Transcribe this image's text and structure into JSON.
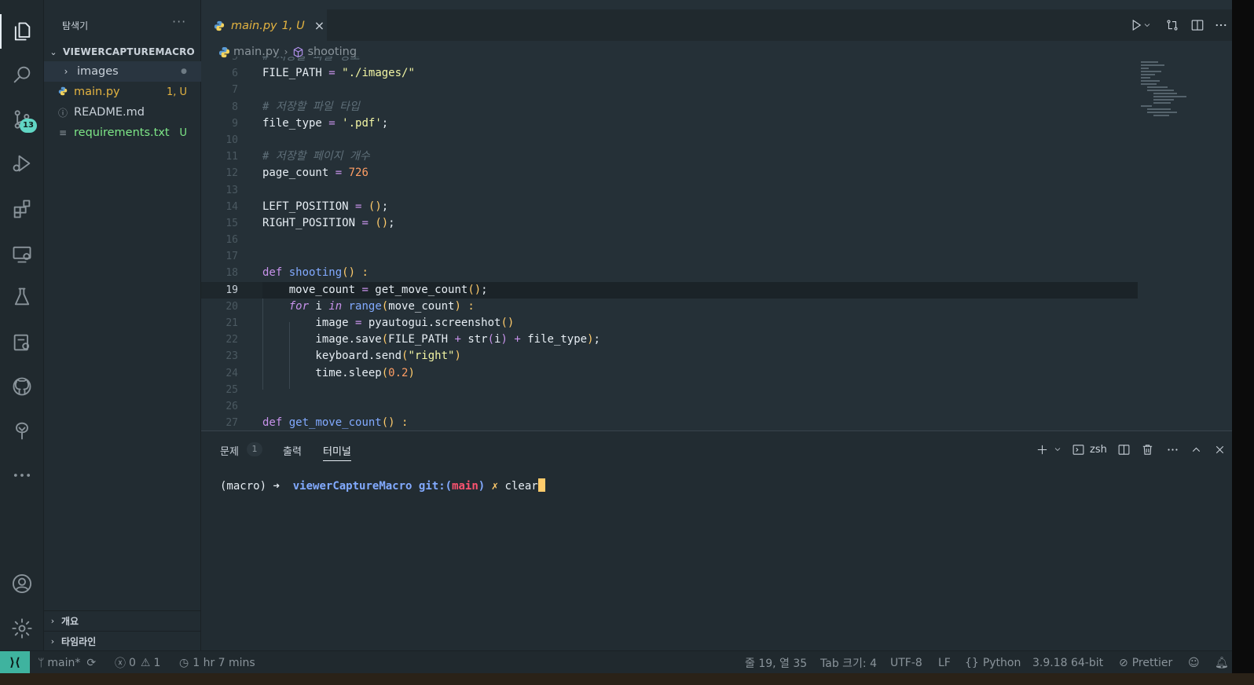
{
  "sidebar": {
    "title": "탐색기",
    "more": "···",
    "root": "VIEWERCAPTUREMACRO",
    "items": [
      {
        "label": "images",
        "status": "●",
        "icon": "chevron-right-icon",
        "color": "#c9d1d9"
      },
      {
        "label": "main.py",
        "status": "1, U",
        "icon": "python-icon",
        "color": "#e3b341"
      },
      {
        "label": "README.md",
        "status": "",
        "icon": "info-icon",
        "color": "#c9d1d9"
      },
      {
        "label": "requirements.txt",
        "status": "U",
        "icon": "lines-icon",
        "color": "#7ee787"
      }
    ],
    "outline_label": "개요",
    "timeline_label": "타임라인"
  },
  "activity": {
    "scm_badge": "13"
  },
  "tab": {
    "name": "main.py",
    "status": "1, U",
    "close": "×"
  },
  "breadcrumb": {
    "file": "main.py",
    "symbol": "shooting"
  },
  "code": [
    {
      "n": "5",
      "segs": [
        {
          "t": "# 저장할 파일 경로",
          "c": "c-com"
        }
      ]
    },
    {
      "n": "6",
      "segs": [
        {
          "t": "FILE_PATH ",
          "c": ""
        },
        {
          "t": "=",
          "c": "c-op"
        },
        {
          "t": " ",
          "c": ""
        },
        {
          "t": "\"./images/\"",
          "c": "c-strv"
        }
      ]
    },
    {
      "n": "7",
      "segs": []
    },
    {
      "n": "8",
      "segs": [
        {
          "t": "# 저장할 파일 타입",
          "c": "c-com"
        }
      ]
    },
    {
      "n": "9",
      "segs": [
        {
          "t": "file_type ",
          "c": ""
        },
        {
          "t": "=",
          "c": "c-op"
        },
        {
          "t": " ",
          "c": ""
        },
        {
          "t": "'.pdf'",
          "c": "c-strv"
        },
        {
          "t": ";",
          "c": ""
        }
      ]
    },
    {
      "n": "10",
      "segs": []
    },
    {
      "n": "11",
      "segs": [
        {
          "t": "# 저장할 페이지 개수",
          "c": "c-com"
        }
      ]
    },
    {
      "n": "12",
      "segs": [
        {
          "t": "page_count ",
          "c": ""
        },
        {
          "t": "=",
          "c": "c-op"
        },
        {
          "t": " ",
          "c": ""
        },
        {
          "t": "726",
          "c": "c-num"
        }
      ]
    },
    {
      "n": "13",
      "segs": []
    },
    {
      "n": "14",
      "segs": [
        {
          "t": "LEFT_POSITION ",
          "c": ""
        },
        {
          "t": "=",
          "c": "c-op"
        },
        {
          "t": " ",
          "c": ""
        },
        {
          "t": "()",
          "c": "c-pn"
        },
        {
          "t": ";",
          "c": ""
        }
      ]
    },
    {
      "n": "15",
      "segs": [
        {
          "t": "RIGHT_POSITION ",
          "c": ""
        },
        {
          "t": "=",
          "c": "c-op"
        },
        {
          "t": " ",
          "c": ""
        },
        {
          "t": "()",
          "c": "c-pn"
        },
        {
          "t": ";",
          "c": ""
        }
      ]
    },
    {
      "n": "16",
      "segs": []
    },
    {
      "n": "17",
      "segs": []
    },
    {
      "n": "18",
      "segs": [
        {
          "t": "def",
          "c": "c-kw"
        },
        {
          "t": " ",
          "c": ""
        },
        {
          "t": "shooting",
          "c": "c-fn"
        },
        {
          "t": "()",
          "c": "c-pn"
        },
        {
          "t": " ",
          "c": ""
        },
        {
          "t": ":",
          "c": "c-pn"
        }
      ]
    },
    {
      "n": "19",
      "cur": true,
      "segs": [
        {
          "t": "    move_count ",
          "c": ""
        },
        {
          "t": "=",
          "c": "c-op"
        },
        {
          "t": " get_move_count",
          "c": ""
        },
        {
          "t": "()",
          "c": "c-pn"
        },
        {
          "t": ";",
          "c": ""
        }
      ]
    },
    {
      "n": "20",
      "segs": [
        {
          "t": "    ",
          "c": ""
        },
        {
          "t": "for",
          "c": "c-kwi"
        },
        {
          "t": " i ",
          "c": ""
        },
        {
          "t": "in",
          "c": "c-kwi"
        },
        {
          "t": " ",
          "c": ""
        },
        {
          "t": "range",
          "c": "c-fn"
        },
        {
          "t": "(",
          "c": "c-pn"
        },
        {
          "t": "move_count",
          "c": ""
        },
        {
          "t": ")",
          "c": "c-pn"
        },
        {
          "t": " ",
          "c": ""
        },
        {
          "t": ":",
          "c": "c-pn"
        }
      ]
    },
    {
      "n": "21",
      "segs": [
        {
          "t": "        image ",
          "c": ""
        },
        {
          "t": "=",
          "c": "c-op"
        },
        {
          "t": " pyautogui.screenshot",
          "c": ""
        },
        {
          "t": "()",
          "c": "c-pn"
        }
      ]
    },
    {
      "n": "22",
      "segs": [
        {
          "t": "        image.save",
          "c": ""
        },
        {
          "t": "(",
          "c": "c-pn"
        },
        {
          "t": "FILE_PATH ",
          "c": ""
        },
        {
          "t": "+",
          "c": "c-op"
        },
        {
          "t": " str",
          "c": ""
        },
        {
          "t": "(",
          "c": "c-pn2"
        },
        {
          "t": "i",
          "c": ""
        },
        {
          "t": ")",
          "c": "c-pn2"
        },
        {
          "t": " ",
          "c": ""
        },
        {
          "t": "+",
          "c": "c-op"
        },
        {
          "t": " file_type",
          "c": ""
        },
        {
          "t": ")",
          "c": "c-pn"
        },
        {
          "t": ";",
          "c": ""
        }
      ]
    },
    {
      "n": "23",
      "segs": [
        {
          "t": "        keyboard.send",
          "c": ""
        },
        {
          "t": "(",
          "c": "c-pn"
        },
        {
          "t": "\"right\"",
          "c": "c-strv"
        },
        {
          "t": ")",
          "c": "c-pn"
        }
      ]
    },
    {
      "n": "24",
      "segs": [
        {
          "t": "        time.sleep",
          "c": ""
        },
        {
          "t": "(",
          "c": "c-pn"
        },
        {
          "t": "0.2",
          "c": "c-num"
        },
        {
          "t": ")",
          "c": "c-pn"
        }
      ]
    },
    {
      "n": "25",
      "segs": []
    },
    {
      "n": "26",
      "segs": []
    },
    {
      "n": "27",
      "segs": [
        {
          "t": "def",
          "c": "c-kw"
        },
        {
          "t": " ",
          "c": ""
        },
        {
          "t": "get_move_count",
          "c": "c-fn"
        },
        {
          "t": "()",
          "c": "c-pn"
        },
        {
          "t": " ",
          "c": ""
        },
        {
          "t": ":",
          "c": "c-pn"
        }
      ]
    }
  ],
  "panel": {
    "tabs": [
      "문제",
      "출력",
      "터미널"
    ],
    "problem_count": "1",
    "shell": "zsh"
  },
  "terminal": {
    "env": "(macro)",
    "arrow": "➜",
    "dir": "viewerCaptureMacro",
    "git": "git:(",
    "branch": "main",
    "git_close": ")",
    "dirty": "✗",
    "command": "clear"
  },
  "status": {
    "remote": "⟩⟨",
    "branch": "main*",
    "errors": "0",
    "warnings": "1",
    "time": "1 hr 7 mins",
    "position": "줄 19, 열 35",
    "tab_size": "Tab 크기: 4",
    "encoding": "UTF-8",
    "eol": "LF",
    "language": "Python",
    "interpreter": "3.9.18 64-bit",
    "formatter": "Prettier"
  },
  "colors": {
    "accent": "#3fb39f",
    "modified": "#e3b341",
    "untracked": "#7ee787"
  }
}
